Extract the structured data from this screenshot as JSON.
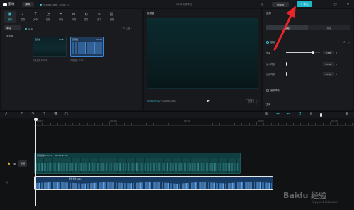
{
  "app": {
    "name": "剪映",
    "menu_label": "菜单",
    "autosave_text": "自动保存本地 10:55:13",
    "doc_title": "0401剪辑项目"
  },
  "titlebar": {
    "shortcut_label": "快捷键",
    "export_label": "导出"
  },
  "tool_tabs": [
    {
      "label": "媒体",
      "icon": "media-icon",
      "glyph": "▣"
    },
    {
      "label": "音频",
      "icon": "audio-icon",
      "glyph": "♪"
    },
    {
      "label": "文本",
      "icon": "text-icon",
      "glyph": "T"
    },
    {
      "label": "贴纸",
      "icon": "sticker-icon",
      "glyph": "◔"
    },
    {
      "label": "特效",
      "icon": "effects-icon",
      "glyph": "✦"
    },
    {
      "label": "转场",
      "icon": "transition-icon",
      "glyph": "⋈"
    },
    {
      "label": "滤镜",
      "icon": "filter-icon",
      "glyph": "◐"
    },
    {
      "label": "调节",
      "icon": "adjust-icon",
      "glyph": "≡"
    },
    {
      "label": "模板",
      "icon": "template-icon",
      "glyph": "▤"
    }
  ],
  "side_nav": [
    {
      "label": "本地",
      "active": true
    },
    {
      "label": "素材库",
      "active": false
    }
  ],
  "media": {
    "import_label": "导入",
    "sort_label": "全部",
    "items": [
      {
        "name": "背景素材1.mp4",
        "duration": "00:33",
        "type": "video"
      },
      {
        "name": "背景音乐.mp3",
        "duration": "02:00",
        "type": "audio"
      }
    ]
  },
  "player": {
    "title": "播放器",
    "current_time": "00:00:00:00",
    "total_time": "00:00:33:01",
    "ratio_label": "比例"
  },
  "right_panel": {
    "title": "音频",
    "tabs": [
      {
        "label": "基础",
        "active": true
      },
      {
        "label": "变速",
        "active": false
      }
    ],
    "section_label": "基础",
    "rows": [
      {
        "label": "音量",
        "value": "0.0dB",
        "level": 0.8
      },
      {
        "label": "淡入时长",
        "value": "0.0s",
        "level": 0.0
      },
      {
        "label": "淡出时长",
        "value": "0.0s",
        "level": 0.0
      }
    ],
    "denoise_label": "音频降噪",
    "changer_label": "变声"
  },
  "timeline": {
    "ticks": [
      "00:00",
      "00:10",
      "00:20",
      "00:30",
      "00:40"
    ],
    "cover_label": "封面",
    "video_clip": {
      "name": "背景素材1.mp4",
      "duration": "00:00:33:01"
    },
    "audio_clip": {
      "name": "背景音乐.mp3"
    }
  },
  "watermark": {
    "text": "Baidu 经验",
    "sub": "jingyan.baidu.com"
  },
  "colors": {
    "accent": "#20b7c9",
    "video_clip": "#0f3d40",
    "audio_clip": "#173a63",
    "arrow": "#e8262a"
  }
}
